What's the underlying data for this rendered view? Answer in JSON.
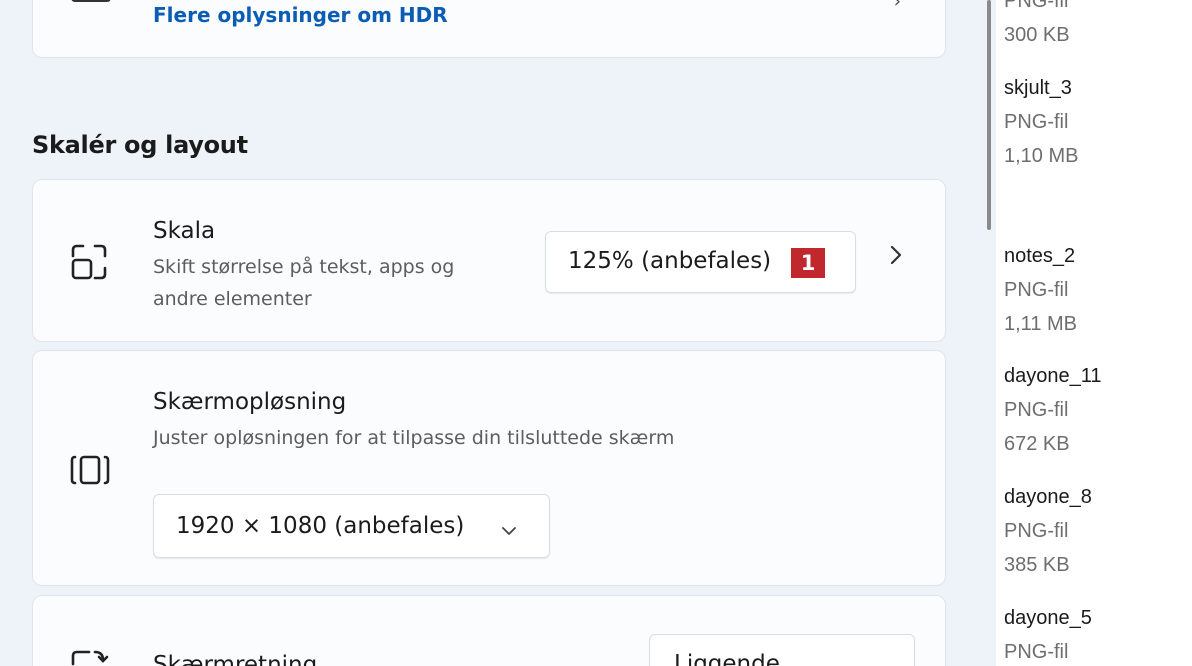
{
  "hdr": {
    "link": "Flere oplysninger om HDR"
  },
  "section": {
    "title": "Skalér og layout"
  },
  "scale": {
    "title": "Skala",
    "desc_line1": "Skift størrelse på tekst, apps og",
    "desc_line2": "andre elementer",
    "value": "125% (anbefales)",
    "badge": "1",
    "icon": "scale-icon",
    "chevron_icon": "chevron-right-icon"
  },
  "resolution": {
    "title": "Skærmopløsning",
    "desc": "Juster  opløsningen for at tilpasse din tilsluttede skærm",
    "value": "1920 × 1080 (anbefales)",
    "icon": "resolution-icon"
  },
  "orientation": {
    "title": "Skærmretning",
    "value": "Liggende",
    "icon": "orientation-icon"
  },
  "files": [
    {
      "name": "",
      "type": "PNG-fil",
      "size": "300 KB"
    },
    {
      "name": "skjult_3",
      "type": "PNG-fil",
      "size": "1,10 MB"
    },
    {
      "name": "notes_2",
      "type": "PNG-fil",
      "size": "1,11 MB"
    },
    {
      "name": "dayone_11",
      "type": "PNG-fil",
      "size": "672 KB"
    },
    {
      "name": "dayone_8",
      "type": "PNG-fil",
      "size": "385 KB"
    },
    {
      "name": "dayone_5",
      "type": "PNG-fil",
      "size": ""
    }
  ],
  "colors": {
    "link": "#0a5cb5",
    "badge": "#c0282e",
    "background": "#eef3f9"
  }
}
